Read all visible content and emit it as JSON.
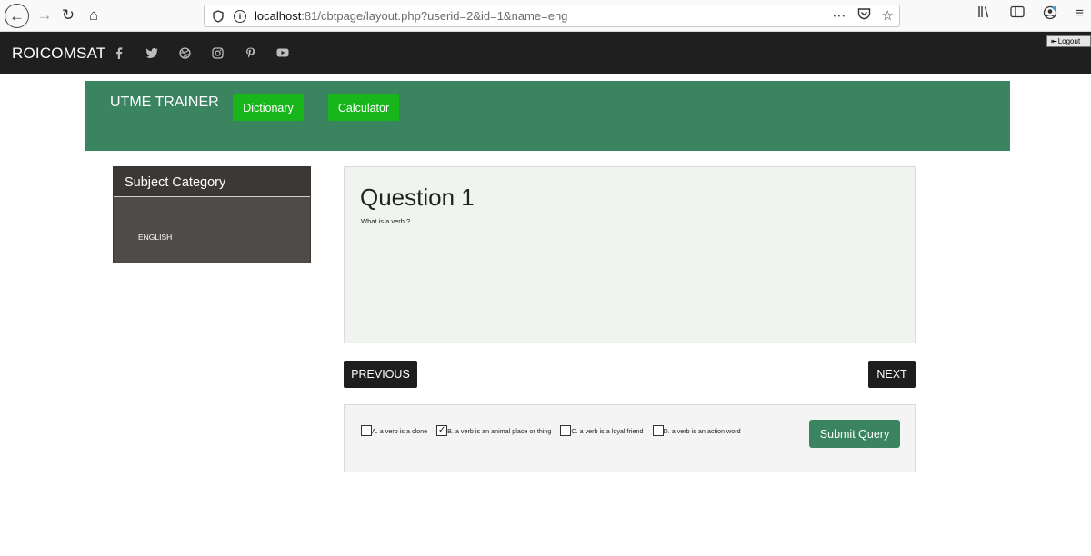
{
  "browser": {
    "url_host": "localhost",
    "url_path": ":81/cbtpage/layout.php?userid=2&id=1&name=eng",
    "icons": [
      "back-icon",
      "forward-icon",
      "reload-icon",
      "home-icon",
      "shield-icon",
      "info-icon",
      "more-icon",
      "pocket-icon",
      "bookmark-star-icon",
      "library-icon",
      "sidebar-icon",
      "account-icon",
      "menu-icon"
    ]
  },
  "site": {
    "brand": "ROICOMSAT",
    "social": [
      "facebook-icon",
      "twitter-icon",
      "dribbble-icon",
      "instagram-icon",
      "pinterest-icon",
      "youtube-icon"
    ],
    "logout_label": "Logout"
  },
  "header": {
    "title": "UTME TRAINER",
    "dictionary_label": "Dictionary",
    "calculator_label": "Calculator",
    "color": "#3a8460",
    "button_color": "#18b61b"
  },
  "sidebar": {
    "heading": "Subject Category",
    "items": [
      {
        "label": "ENGLISH"
      }
    ]
  },
  "question": {
    "title": "Question 1",
    "text": "What is a verb ?"
  },
  "navigation": {
    "previous_label": "PREVIOUS",
    "next_label": "NEXT"
  },
  "options": [
    {
      "label": "A. a verb is a clone",
      "checked": false
    },
    {
      "label": "B. a verb is an animal place or thing",
      "checked": true
    },
    {
      "label": "C. a verb is a loyal friend",
      "checked": false
    },
    {
      "label": "D. a verb is an action word",
      "checked": false
    }
  ],
  "submit_label": "Submit Query"
}
